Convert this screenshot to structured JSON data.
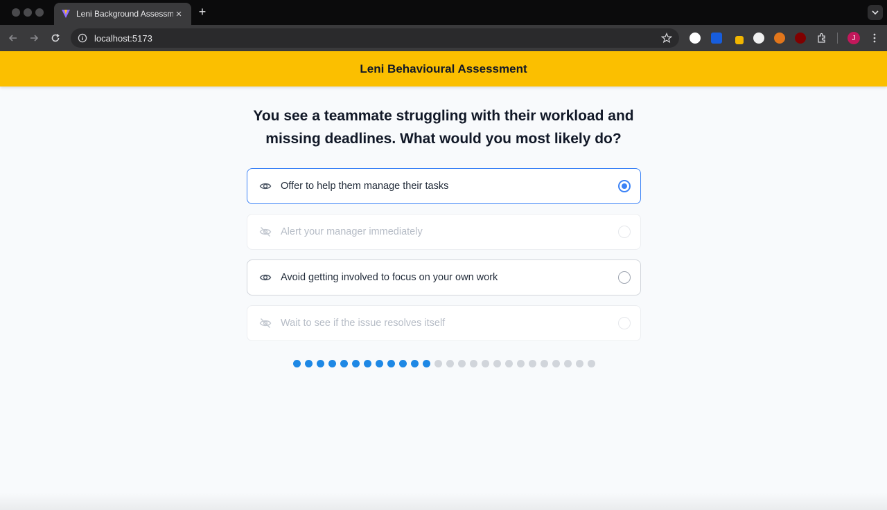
{
  "browser": {
    "tab_title": "Leni Background Assessment",
    "url": "localhost:5173",
    "new_tab_label": "+",
    "close_label": "×",
    "profile_initial": "J"
  },
  "app": {
    "header_title": "Leni Behavioural Assessment",
    "question": "You see a teammate struggling with their workload and missing deadlines. What would you most likely do?"
  },
  "options": [
    {
      "label": "Offer to help them manage their tasks",
      "state": "selected",
      "icon": "eye-icon"
    },
    {
      "label": "Alert your manager immediately",
      "state": "disabled",
      "icon": "eye-off-icon"
    },
    {
      "label": "Avoid getting involved to focus on your own work",
      "state": "default",
      "icon": "eye-icon"
    },
    {
      "label": "Wait to see if the issue resolves itself",
      "state": "disabled",
      "icon": "eye-off-icon"
    }
  ],
  "progress": {
    "completed": 12,
    "total": 26
  },
  "colors": {
    "header": "#fbbf00",
    "accent": "#3b82f6",
    "progress_done": "#1e88e5",
    "progress_todo": "#d1d5db"
  }
}
